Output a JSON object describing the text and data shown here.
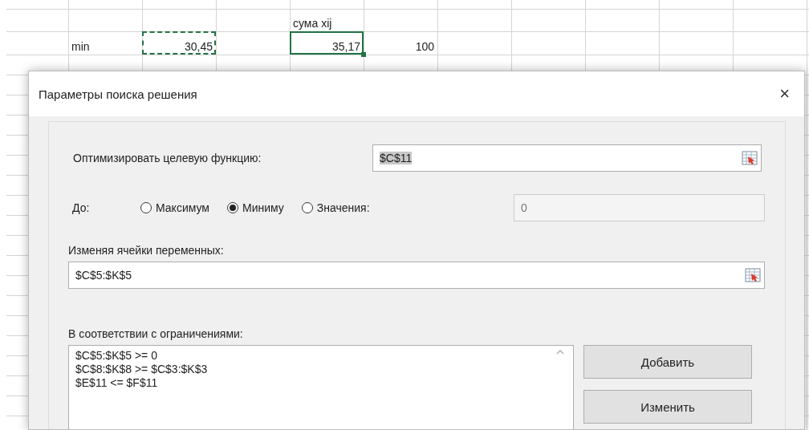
{
  "spreadsheet": {
    "rows": [
      {
        "cells": [
          null,
          null,
          null,
          null,
          {
            "text": "сума xij",
            "kind": "text",
            "selected": false,
            "copied": false
          }
        ]
      },
      {
        "cells": [
          null,
          {
            "text": "min",
            "kind": "text",
            "selected": false,
            "copied": false
          },
          {
            "text": "30,45",
            "kind": "number",
            "selected": false,
            "copied": true
          },
          null,
          {
            "text": "35,17",
            "kind": "number",
            "selected": true,
            "copied": false
          },
          {
            "text": "100",
            "kind": "number",
            "selected": false,
            "copied": false
          }
        ]
      }
    ]
  },
  "dialog": {
    "title": "Параметры поиска решения",
    "close": "×",
    "objective": {
      "label": "Оптимизировать целевую функцию:",
      "value": "$C$11",
      "highlighted": true
    },
    "to": {
      "label": "До:",
      "options": [
        {
          "label": "Максимум",
          "selected": false
        },
        {
          "label": "Миниму",
          "selected": true
        },
        {
          "label": "Значения:",
          "selected": false
        }
      ],
      "value_field": {
        "value": "0",
        "disabled": true
      }
    },
    "variables": {
      "label": "Изменяя ячейки переменных:",
      "value": "$C$5:$K$5"
    },
    "constraints": {
      "label": "В соответствии с ограничениями:",
      "items": [
        "$C$5:$K$5 >= 0",
        "$C$8:$K$8 >= $C$3:$K$3",
        "$E$11 <= $F$11"
      ]
    },
    "buttons": [
      "Добавить",
      "Изменить"
    ]
  }
}
